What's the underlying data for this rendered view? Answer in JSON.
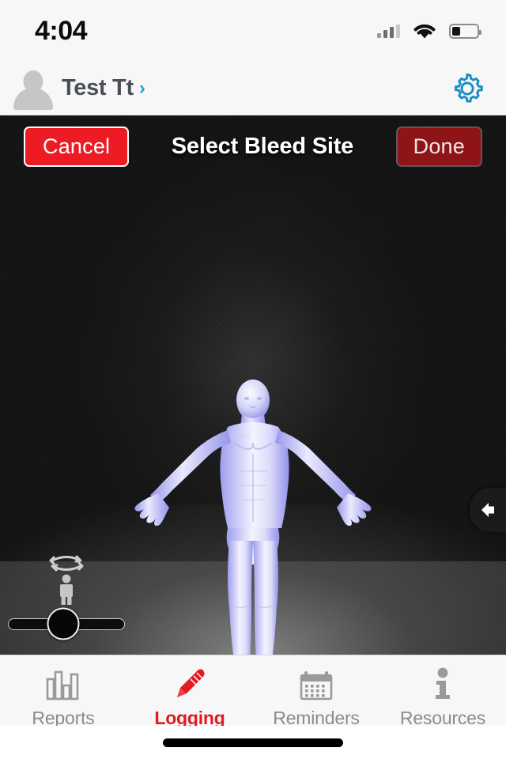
{
  "status_bar": {
    "time": "4:04",
    "signal_icon": "cellular-signal-icon",
    "wifi_icon": "wifi-icon",
    "battery_icon": "battery-icon",
    "battery_level_percent": 32
  },
  "profile_header": {
    "avatar_icon": "avatar-placeholder-icon",
    "user_name": "Test Tt",
    "chevron": "›",
    "settings_icon": "gear-icon",
    "settings_color": "#1a8cc4"
  },
  "nav_bar": {
    "cancel_label": "Cancel",
    "title": "Select Bleed Site",
    "done_label": "Done",
    "cancel_color": "#ed1c24",
    "done_color": "#8f1418"
  },
  "model_view": {
    "model_name": "human-body-3d-model",
    "pose": "a-pose-front",
    "body_color": "#e9e9fb",
    "shade_color": "#a3a3ef",
    "background_color": "#141414"
  },
  "rotate_control": {
    "icon": "rotate-model-icon",
    "person_icon": "person-figure-icon",
    "slider_name": "rotation-slider",
    "thumb_position_percent": 47
  },
  "drawer_toggle": {
    "icon": "arrow-left-icon",
    "label": ""
  },
  "tab_bar": {
    "items": [
      {
        "label": "Reports",
        "icon": "bar-chart-icon",
        "active": false
      },
      {
        "label": "Logging",
        "icon": "pencil-icon",
        "active": true
      },
      {
        "label": "Reminders",
        "icon": "calendar-icon",
        "active": false
      },
      {
        "label": "Resources",
        "icon": "info-icon",
        "active": false
      }
    ],
    "active_color": "#e01b22",
    "inactive_color": "#8b8b8b"
  },
  "home_indicator": {
    "name": "home-indicator"
  }
}
